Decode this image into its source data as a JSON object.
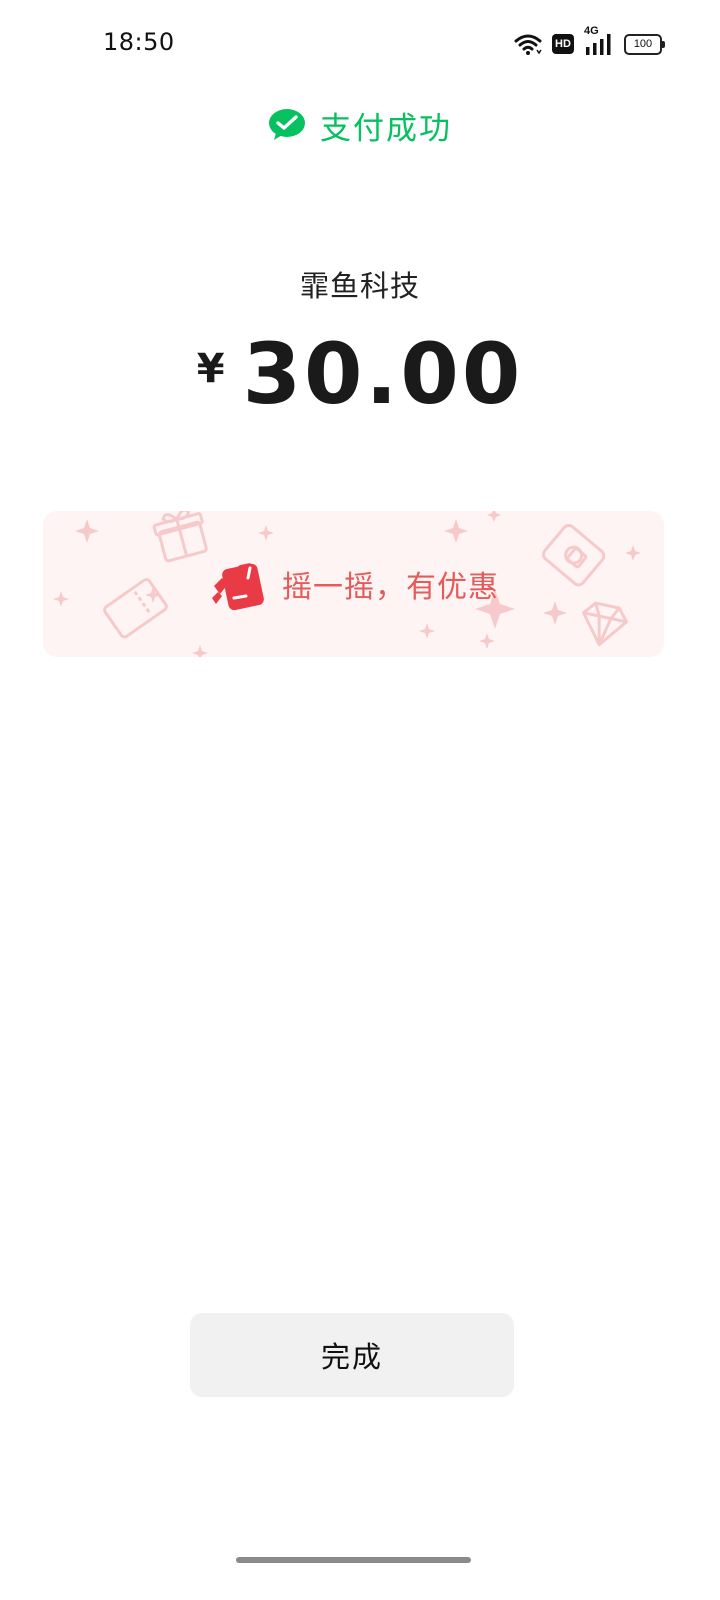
{
  "status_bar": {
    "time": "18:50",
    "hd_label": "HD",
    "network_label": "4G",
    "battery_level": "100",
    "icons": [
      "wifi-icon",
      "hd-icon",
      "signal-icon",
      "battery-icon"
    ]
  },
  "header": {
    "title": "支付成功",
    "icon": "wechat-pay-icon",
    "accent_color": "#07c160"
  },
  "payment": {
    "merchant": "霏鱼科技",
    "currency_symbol": "¥",
    "amount": "30.00"
  },
  "banner": {
    "text": "摇一摇，有优惠",
    "icon": "shake-hand-icon",
    "text_color": "#e55a5a",
    "background_color": "#fff4f4"
  },
  "footer": {
    "done_label": "完成"
  }
}
